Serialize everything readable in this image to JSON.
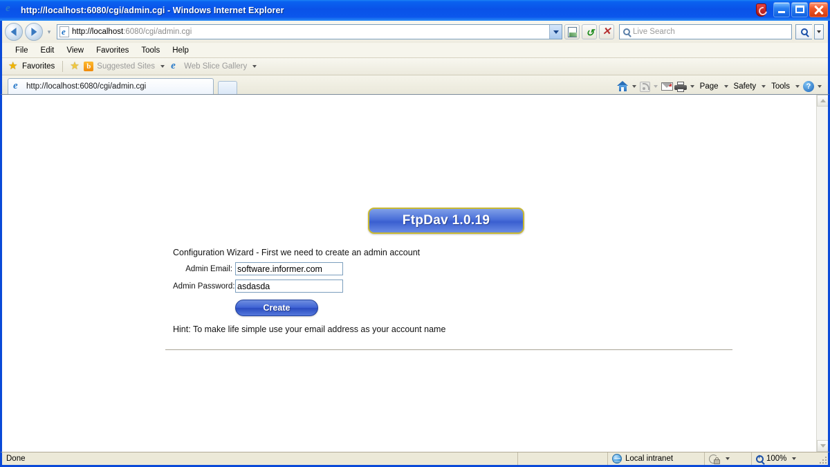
{
  "window": {
    "title": "http://localhost:6080/cgi/admin.cgi - Windows Internet Explorer",
    "minimize_label": "Minimize",
    "maximize_label": "Maximize",
    "close_label": "Close"
  },
  "address_bar": {
    "url_host": "http://localhost",
    "url_rest": ":6080/cgi/admin.cgi",
    "back_label": "Back",
    "forward_label": "Forward",
    "compatibility_label": "Compatibility View",
    "refresh_label": "Refresh",
    "stop_label": "Stop",
    "search_placeholder": "Live Search",
    "search_value": ""
  },
  "menu": {
    "items": [
      {
        "label": "File"
      },
      {
        "label": "Edit"
      },
      {
        "label": "View"
      },
      {
        "label": "Favorites"
      },
      {
        "label": "Tools"
      },
      {
        "label": "Help"
      }
    ]
  },
  "favorites_bar": {
    "favorites_label": "Favorites",
    "suggested_sites_label": "Suggested Sites",
    "web_slice_label": "Web Slice Gallery"
  },
  "tabs": {
    "items": [
      {
        "label": "http://localhost:6080/cgi/admin.cgi"
      }
    ],
    "new_tab_label": "New Tab"
  },
  "command_bar": {
    "home_label": "Home",
    "feeds_label": "Feeds",
    "mail_label": "Read Mail",
    "print_label": "Print",
    "page_label": "Page",
    "safety_label": "Safety",
    "tools_label": "Tools",
    "help_label": "Help"
  },
  "page": {
    "logo_text": "FtpDav 1.0.19",
    "wizard_text": "Configuration Wizard - First we need to create an admin account",
    "fields": [
      {
        "label": "Admin Email:",
        "value": "software.informer.com",
        "placeholder": ""
      },
      {
        "label": "Admin Password:",
        "value": "asdasda",
        "placeholder": ""
      }
    ],
    "create_button": "Create",
    "hint_text": "Hint: To make life simple use your email address as your account name"
  },
  "status_bar": {
    "status_text": "Done",
    "zone_text": "Local intranet",
    "protected_mode_label": "Protected Mode",
    "zoom_level": "100%"
  },
  "colors": {
    "title_bar_blue": "#0a52e8",
    "chrome_cream": "#f6f5ec",
    "logo_blue": "#4a6fd8",
    "logo_border_yellow": "#c8b830",
    "button_blue": "#3f63d4",
    "status_bar": "#ece9d8"
  }
}
